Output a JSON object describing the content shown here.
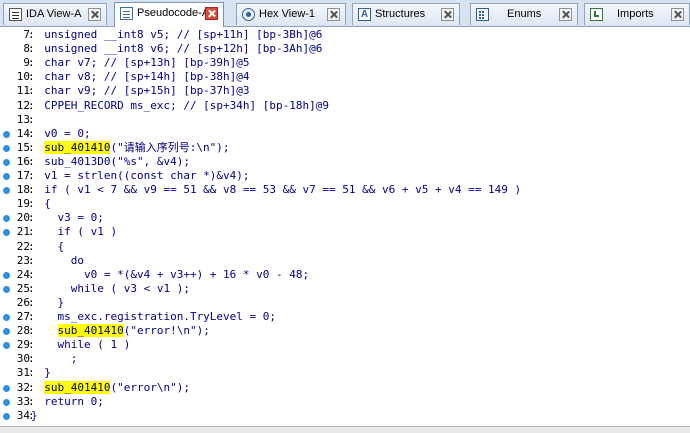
{
  "tabs": [
    {
      "label": "IDA View-A",
      "icon": "ida-view-icon"
    },
    {
      "label": "Pseudocode-A",
      "icon": "pseudocode-icon"
    },
    {
      "label": "Hex View-1",
      "icon": "hex-view-icon"
    },
    {
      "label": "Structures",
      "icon": "structures-icon"
    },
    {
      "label": "Enums",
      "icon": "enums-icon"
    },
    {
      "label": "Imports",
      "icon": "imports-icon"
    }
  ],
  "code_lines": [
    {
      "num": "7",
      "dot": false,
      "text": "  unsigned __int8 v5; // [sp+11h] [bp-3Bh]@6"
    },
    {
      "num": "8",
      "dot": false,
      "text": "  unsigned __int8 v6; // [sp+12h] [bp-3Ah]@6"
    },
    {
      "num": "9",
      "dot": false,
      "text": "  char v7; // [sp+13h] [bp-39h]@5"
    },
    {
      "num": "10",
      "dot": false,
      "text": "  char v8; // [sp+14h] [bp-38h]@4"
    },
    {
      "num": "11",
      "dot": false,
      "text": "  char v9; // [sp+15h] [bp-37h]@3"
    },
    {
      "num": "12",
      "dot": false,
      "text": "  CPPEH_RECORD ms_exc; // [sp+34h] [bp-18h]@9"
    },
    {
      "num": "13",
      "dot": false,
      "text": ""
    },
    {
      "num": "14",
      "dot": true,
      "text": "  v0 = 0;"
    },
    {
      "num": "15",
      "dot": true,
      "text": "  sub_401410(\"请输入序列号:\\n\");"
    },
    {
      "num": "16",
      "dot": true,
      "text": "  sub_4013D0(\"%s\", &v4);"
    },
    {
      "num": "17",
      "dot": true,
      "text": "  v1 = strlen((const char *)&v4);"
    },
    {
      "num": "18",
      "dot": true,
      "text": "  if ( v1 < 7 && v9 == 51 && v8 == 53 && v7 == 51 && v6 + v5 + v4 == 149 )"
    },
    {
      "num": "19",
      "dot": false,
      "text": "  {"
    },
    {
      "num": "20",
      "dot": true,
      "text": "    v3 = 0;"
    },
    {
      "num": "21",
      "dot": true,
      "text": "    if ( v1 )"
    },
    {
      "num": "22",
      "dot": false,
      "text": "    {"
    },
    {
      "num": "23",
      "dot": false,
      "text": "      do"
    },
    {
      "num": "24",
      "dot": true,
      "text": "        v0 = *(&v4 + v3++) + 16 * v0 - 48;"
    },
    {
      "num": "25",
      "dot": true,
      "text": "      while ( v3 < v1 );"
    },
    {
      "num": "26",
      "dot": false,
      "text": "    }"
    },
    {
      "num": "27",
      "dot": true,
      "text": "    ms_exc.registration.TryLevel = 0;"
    },
    {
      "num": "28",
      "dot": true,
      "text": "    sub_401410(\"error!\\n\");"
    },
    {
      "num": "29",
      "dot": true,
      "text": "    while ( 1 )"
    },
    {
      "num": "30",
      "dot": false,
      "text": "      ;"
    },
    {
      "num": "31",
      "dot": false,
      "text": "  }"
    },
    {
      "num": "32",
      "dot": true,
      "text": "  sub_401410(\"error\\n\");"
    },
    {
      "num": "33",
      "dot": true,
      "text": "  return 0;"
    },
    {
      "num": "34",
      "dot": true,
      "text": "}"
    }
  ],
  "highlight_token": "sub_401410",
  "colors": {
    "highlight": "#ffff00",
    "dot": "#2f8fe0",
    "code_text": "#000080"
  }
}
